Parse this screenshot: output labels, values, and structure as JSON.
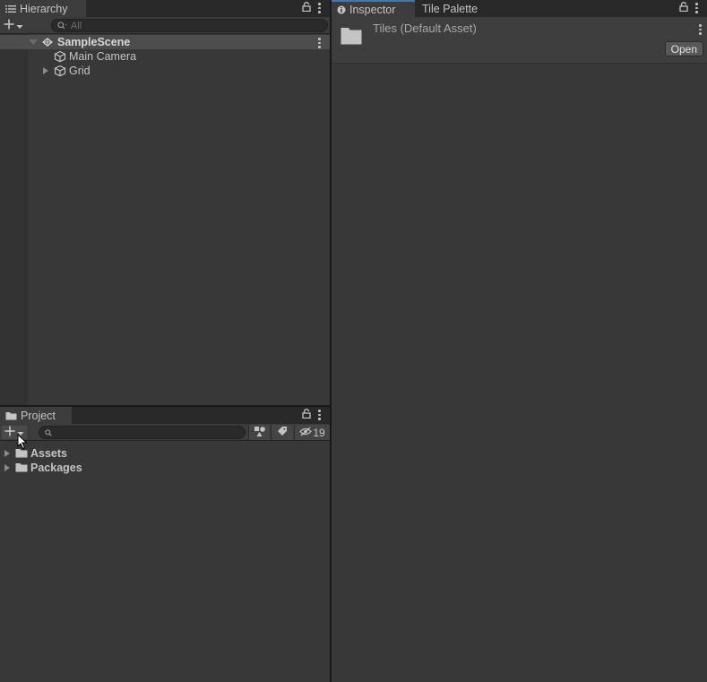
{
  "hierarchy": {
    "tab_label": "Hierarchy",
    "search_placeholder": "All",
    "scene_name": "SampleScene",
    "items": [
      {
        "label": "Main Camera",
        "expandable": false
      },
      {
        "label": "Grid",
        "expandable": true
      }
    ]
  },
  "project": {
    "tab_label": "Project",
    "hidden_packages_count": "19",
    "items": [
      {
        "label": "Assets"
      },
      {
        "label": "Packages"
      }
    ]
  },
  "inspector": {
    "tabs": [
      {
        "label": "Inspector",
        "icon": "info-icon",
        "active": true
      },
      {
        "label": "Tile Palette",
        "active": false
      }
    ],
    "asset_title": "Tiles (Default Asset)",
    "open_label": "Open"
  },
  "colors": {
    "panel_bg": "#383838",
    "tabbar_bg": "#282828",
    "selected_row": "#4d4d4d",
    "accent": "#3a79bb",
    "text": "#c4c4c4"
  }
}
